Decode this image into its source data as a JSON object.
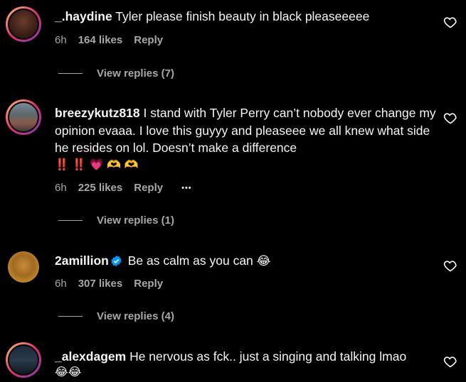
{
  "comments": [
    {
      "username": "_.haydine",
      "text": "Tyler please finish beauty in black pleaseeeee",
      "time": "6h",
      "likes": "164 likes",
      "reply": "Reply",
      "view_replies": "View replies (7)"
    },
    {
      "username": "breezykutz818",
      "text": "I stand with Tyler Perry can’t nobody ever change my opinion evaaa. I love this guyyy and pleaseee we all knew what side he resides on lol. Doesn’t make a difference",
      "emoji_line": "‼️ ‼️ 💗 🫶 🫶",
      "time": "6h",
      "likes": "225 likes",
      "reply": "Reply",
      "more": "•••",
      "view_replies": "View replies (1)"
    },
    {
      "username": "2amillion",
      "text": "Be as calm as you can",
      "emoji": "😂",
      "time": "6h",
      "likes": "307 likes",
      "reply": "Reply",
      "view_replies": "View replies (4)"
    },
    {
      "username": "_alexdagem",
      "text": "He nervous as fck.. just a singing and talking lmao",
      "emoji_line": "😂😂"
    }
  ],
  "icons": {
    "like": "heart-outline-icon",
    "verified": "verified-badge-icon",
    "more": "more-options-icon"
  },
  "colors": {
    "background": "#000000",
    "primary_text": "#f5f5f5",
    "secondary_text": "#a8a8a8",
    "verified": "#0095f6"
  }
}
